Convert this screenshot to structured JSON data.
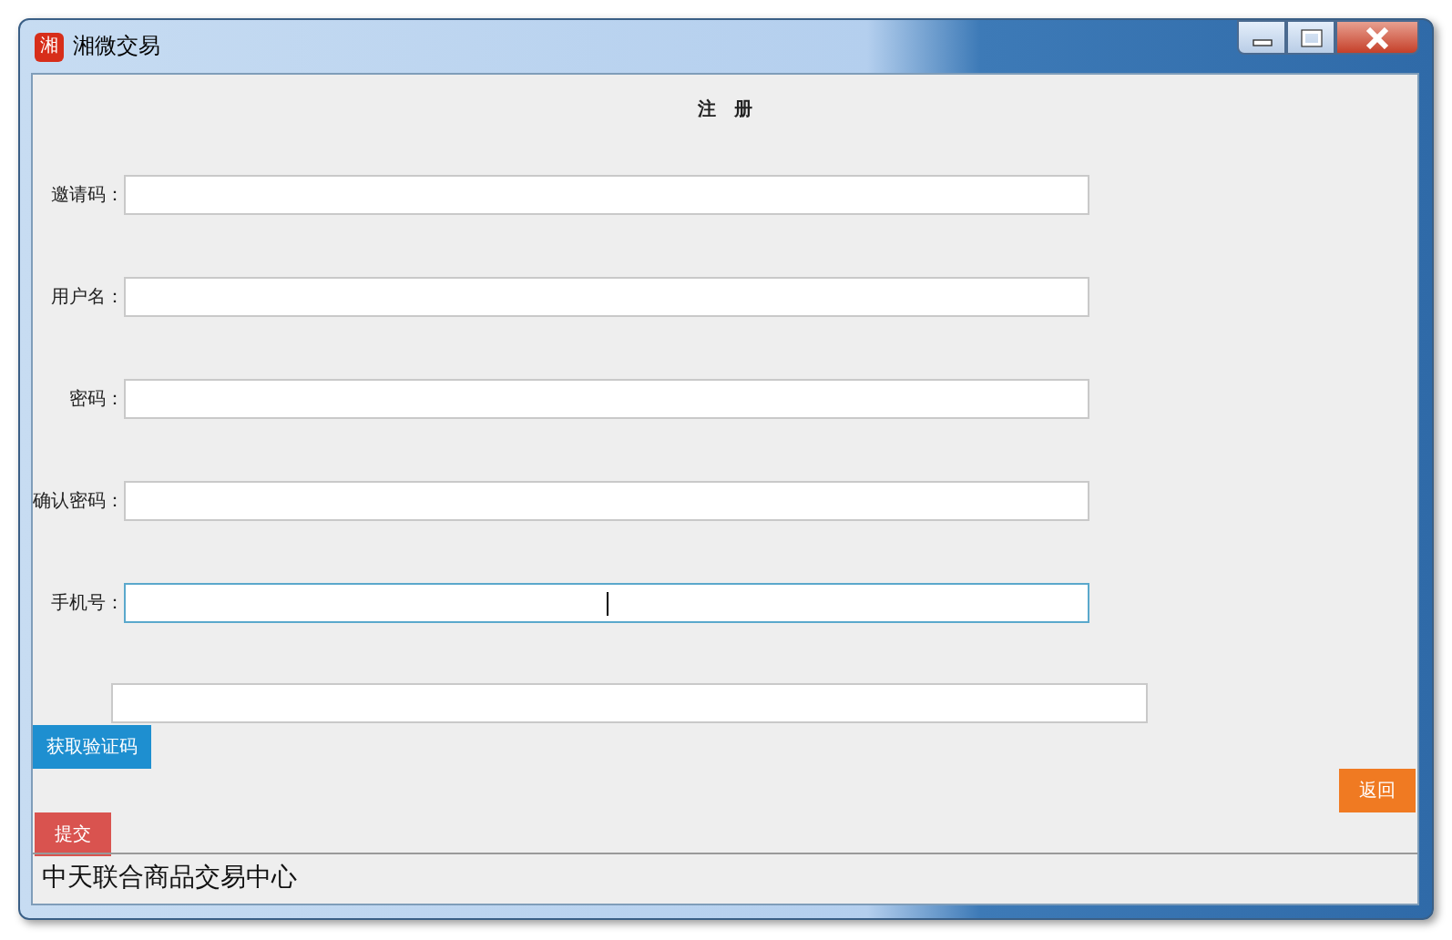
{
  "window": {
    "title": "湘微交易",
    "icon_text": "湘"
  },
  "heading": "注　册",
  "fields": [
    {
      "label": "邀请码：",
      "focused": false
    },
    {
      "label": "用户名：",
      "focused": false
    },
    {
      "label": "密码：",
      "focused": false
    },
    {
      "label": "确认密码：",
      "focused": false
    },
    {
      "label": "手机号：",
      "focused": true
    }
  ],
  "code_field": {
    "focused": false
  },
  "buttons": [
    {
      "kind": "get_code",
      "label": "获取验证码",
      "color": "#1e8fd0"
    },
    {
      "kind": "back",
      "label": "返回",
      "color": "#f07a22"
    },
    {
      "kind": "submit",
      "label": "提交",
      "color": "#d9534f"
    }
  ],
  "status_bar": "中天联合商品交易中心"
}
